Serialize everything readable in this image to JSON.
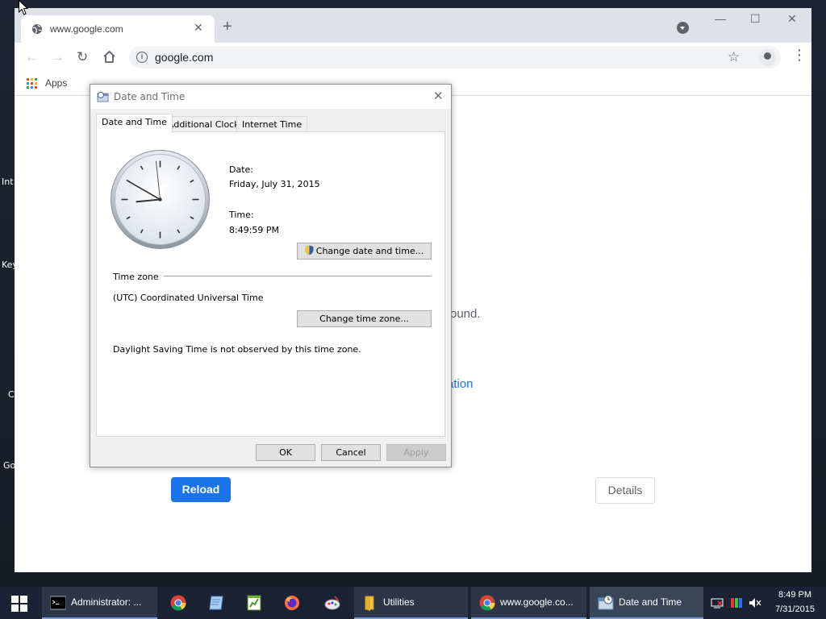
{
  "desktop": {
    "labels": [
      "Int",
      "Key",
      "C",
      "Go"
    ]
  },
  "browser": {
    "tab_title": "www.google.com",
    "new_tab": "+",
    "url": "google.com",
    "bookmarks_apps": "Apps",
    "page": {
      "text_partial": "ound.",
      "link_partial": "ation",
      "reload_label": "Reload",
      "details_label": "Details"
    }
  },
  "dialog": {
    "title": "Date and Time",
    "tabs": [
      "Date and Time",
      "Additional Clocks",
      "Internet Time"
    ],
    "date_label": "Date:",
    "date_value": "Friday, July 31, 2015",
    "time_label": "Time:",
    "time_value": "8:49:59 PM",
    "clock_time": {
      "hour": 8,
      "minute": 49,
      "second": 59
    },
    "change_datetime_label": "Change date and time...",
    "timezone_label": "Time zone",
    "timezone_value": "(UTC) Coordinated Universal Time",
    "change_timezone_label": "Change time zone...",
    "dst_text": "Daylight Saving Time is not observed by this time zone.",
    "ok_label": "OK",
    "cancel_label": "Cancel",
    "apply_label": "Apply"
  },
  "taskbar": {
    "items": [
      {
        "label": "Administrator: ...",
        "icon": "terminal-icon"
      },
      {
        "label": "",
        "icon": "chrome-icon"
      },
      {
        "label": "",
        "icon": "notepad-icon"
      },
      {
        "label": "",
        "icon": "spreadsheet-icon"
      },
      {
        "label": "",
        "icon": "firefox-icon"
      },
      {
        "label": "",
        "icon": "paint-icon"
      },
      {
        "label": "Utilities",
        "icon": "folder-icon"
      },
      {
        "label": "www.google.co...",
        "icon": "chrome-icon"
      },
      {
        "label": "Date and Time",
        "icon": "datetime-icon"
      }
    ],
    "time": "8:49 PM",
    "date": "7/31/2015"
  },
  "colors": {
    "chrome_blue": "#1a73e8",
    "taskbar": "#1b2233",
    "dialog_bg": "#f0f0f0"
  }
}
